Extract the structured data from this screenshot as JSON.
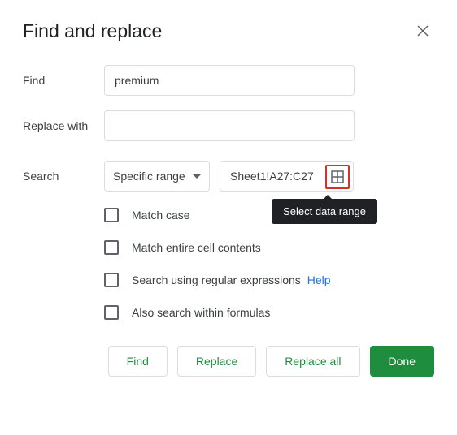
{
  "dialog": {
    "title": "Find and replace"
  },
  "fields": {
    "find": {
      "label": "Find",
      "value": "premium"
    },
    "replace": {
      "label": "Replace with",
      "value": ""
    },
    "search": {
      "label": "Search",
      "scope_selected": "Specific range",
      "range_value": "Sheet1!A27:C27"
    }
  },
  "tooltip": {
    "select_range": "Select data range"
  },
  "options": {
    "match_case": "Match case",
    "match_entire": "Match entire cell contents",
    "regex": "Search using regular expressions",
    "regex_help": "Help",
    "formulas": "Also search within formulas"
  },
  "buttons": {
    "find": "Find",
    "replace": "Replace",
    "replace_all": "Replace all",
    "done": "Done"
  }
}
